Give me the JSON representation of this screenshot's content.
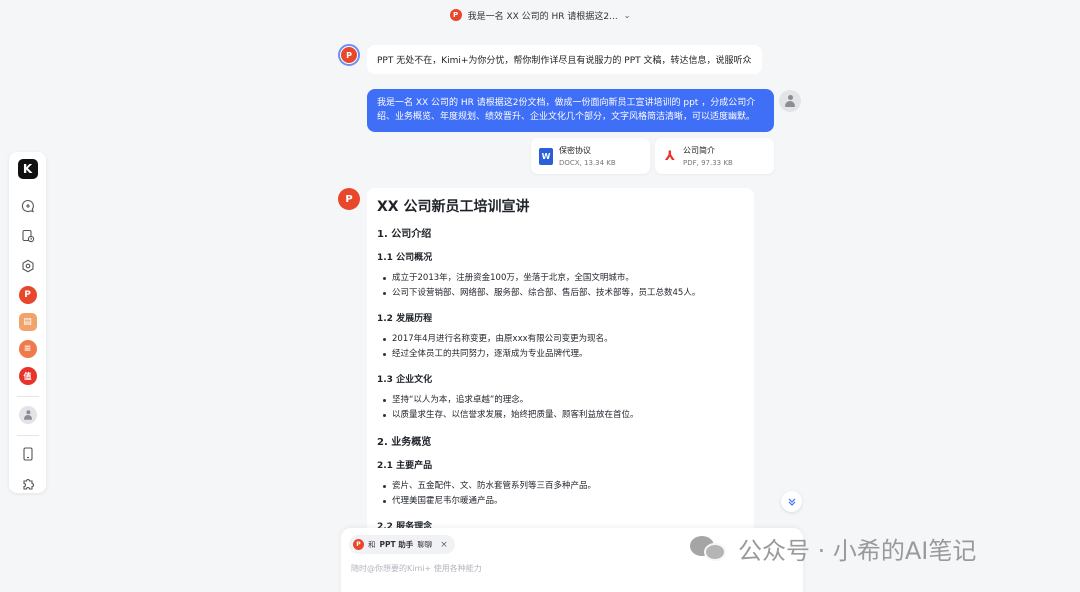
{
  "header": {
    "title": "我是一名 XX 公司的 HR 请根据这2...",
    "icon": "ppt-icon"
  },
  "sidebar": {
    "logo": "K",
    "items": [
      {
        "name": "new-chat",
        "icon": "chat-plus-icon"
      },
      {
        "name": "history",
        "icon": "history-icon"
      },
      {
        "name": "explore",
        "icon": "hexagon-icon"
      },
      {
        "name": "ppt-assistant",
        "icon": "ppt-icon",
        "glyph": "P",
        "color": "#e8472b"
      },
      {
        "name": "writing",
        "icon": "note-icon",
        "glyph": "▤",
        "color": "#f0a36b"
      },
      {
        "name": "summary",
        "icon": "list-icon",
        "glyph": "≡",
        "color": "#f07a4a"
      },
      {
        "name": "deal",
        "icon": "zhi-icon",
        "glyph": "值",
        "color": "#e8332b"
      },
      {
        "name": "profile",
        "icon": "user-icon"
      },
      {
        "name": "mobile",
        "icon": "phone-icon"
      },
      {
        "name": "plugins",
        "icon": "puzzle-icon"
      }
    ]
  },
  "greeting": "PPT 无处不在，Kimi+为你分忧，帮你制作详尽且有说服力的 PPT 文稿，转达信息，说服听众",
  "user_message": "我是一名 XX 公司的 HR 请根据这2份文档，做成一份面向新员工宣讲培训的 ppt ，分成公司介绍、业务概览、年度规划、绩效晋升、企业文化几个部分，文字风格简洁清晰，可以适度幽默。",
  "files": [
    {
      "name": "保密协议",
      "meta": "DOCX, 13.34 KB",
      "icon": "word-icon",
      "glyph": "W",
      "color": "#2b5fd9"
    },
    {
      "name": "公司简介",
      "meta": "PDF, 97.33 KB",
      "icon": "pdf-icon",
      "glyph": "⅄",
      "color": "#e8332b"
    }
  ],
  "answer": {
    "title": "XX 公司新员工培训宣讲",
    "s1": "1. 公司介绍",
    "s1_1": "1.1 公司概况",
    "s1_1_items": [
      "成立于2013年，注册资金100万，坐落于北京，全国文明城市。",
      "公司下设营销部、网络部、服务部、综合部、售后部、技术部等，员工总数45人。"
    ],
    "s1_2": "1.2 发展历程",
    "s1_2_items": [
      "2017年4月进行名称变更，由原xxx有限公司变更为现名。",
      "经过全体员工的共同努力，逐渐成为专业品牌代理。"
    ],
    "s1_3": "1.3 企业文化",
    "s1_3_items": [
      "坚持“以人为本，追求卓越”的理念。",
      "以质量求生存、以信誉求发展，始终把质量、顾客利益放在首位。"
    ],
    "s2": "2. 业务概览",
    "s2_1": "2.1 主要产品",
    "s2_1_items": [
      "瓷片、五金配件、文、防水套管系列等三百多种产品。",
      "代理美国霍尼韦尔暖通产品。"
    ],
    "s2_2": "2.2 服务理念"
  },
  "input": {
    "chip_prefix": "和",
    "chip_name": "PPT 助手",
    "chip_suffix": "聊聊",
    "placeholder": "随时@你想要的Kimi+ 使用各种能力"
  },
  "watermark": "公众号 · 小希的AI笔记"
}
